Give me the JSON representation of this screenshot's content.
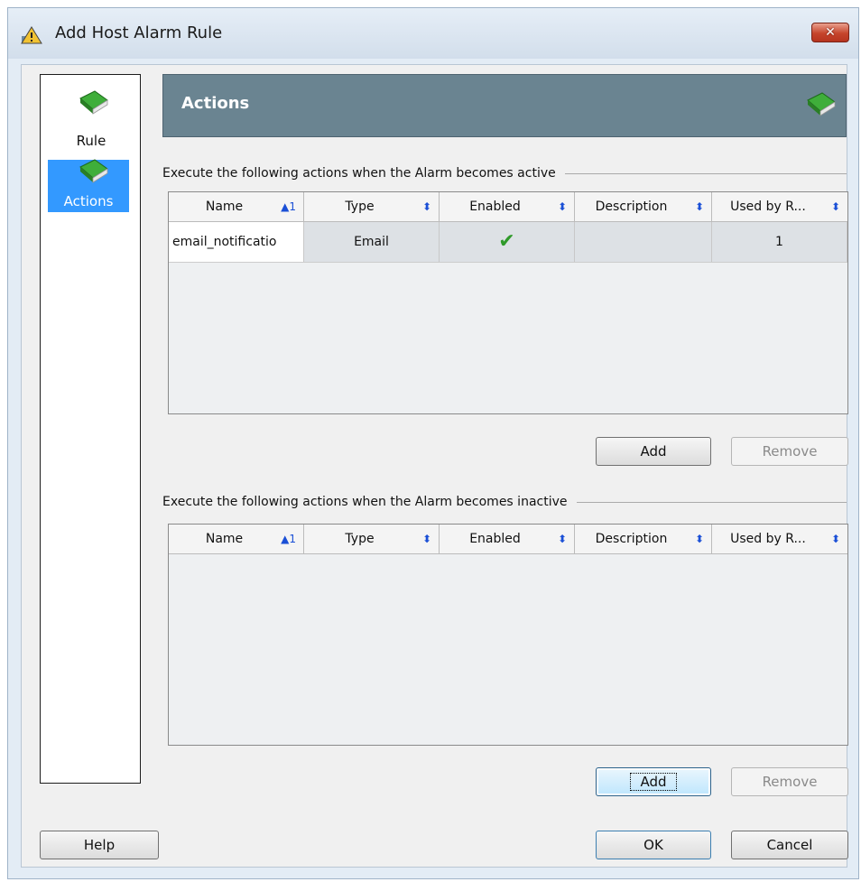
{
  "window": {
    "title": "Add Host Alarm Rule",
    "close_label": "✕"
  },
  "nav": {
    "items": [
      {
        "label": "Rule",
        "icon": "book-icon"
      },
      {
        "label": "Actions",
        "icon": "book-icon",
        "selected": true
      }
    ]
  },
  "section": {
    "title": "Actions"
  },
  "active_group": {
    "label": "Execute the following actions when the Alarm becomes active",
    "columns": [
      "Name",
      "Type",
      "Enabled",
      "Description",
      "Used by R..."
    ],
    "sort_indicator": "▲1",
    "rows": [
      {
        "name": "email_notificatio",
        "type": "Email",
        "enabled": "✔",
        "description": "",
        "used_by": "1"
      }
    ],
    "add_label": "Add",
    "remove_label": "Remove"
  },
  "inactive_group": {
    "label": "Execute the following actions when the Alarm becomes inactive",
    "columns": [
      "Name",
      "Type",
      "Enabled",
      "Description",
      "Used by R..."
    ],
    "sort_indicator": "▲1",
    "add_label": "Add",
    "remove_label": "Remove"
  },
  "footer": {
    "help_label": "Help",
    "ok_label": "OK",
    "cancel_label": "Cancel"
  },
  "colors": {
    "header_bg": "#6a8491",
    "selection": "#3399ff",
    "check": "#2f9a2a",
    "sort_arrow": "#1a4fd6"
  }
}
